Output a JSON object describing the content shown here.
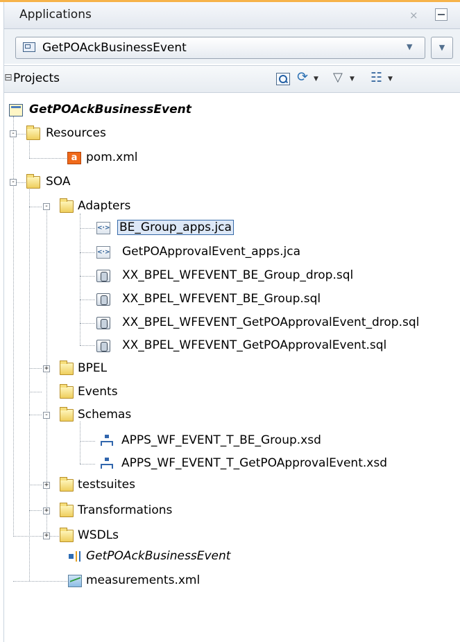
{
  "header": {
    "title": "Applications",
    "close_glyph": "×"
  },
  "app_selector": {
    "value": "GetPOAckBusinessEvent"
  },
  "projects_toolbar": {
    "label": "Projects",
    "icons": [
      "search-icon",
      "sync-icon",
      "filter-icon",
      "layout-icon"
    ]
  },
  "tree": {
    "root": "GetPOAckBusinessEvent",
    "resources": {
      "label": "Resources",
      "children": [
        "pom.xml"
      ]
    },
    "soa": {
      "label": "SOA",
      "adapters": {
        "label": "Adapters",
        "children": [
          "BE_Group_apps.jca",
          "GetPOApprovalEvent_apps.jca",
          "XX_BPEL_WFEVENT_BE_Group_drop.sql",
          "XX_BPEL_WFEVENT_BE_Group.sql",
          "XX_BPEL_WFEVENT_GetPOApprovalEvent_drop.sql",
          "XX_BPEL_WFEVENT_GetPOApprovalEvent.sql"
        ],
        "selected": "BE_Group_apps.jca"
      },
      "bpel": "BPEL",
      "events": "Events",
      "schemas": {
        "label": "Schemas",
        "children": [
          "APPS_WF_EVENT_T_BE_Group.xsd",
          "APPS_WF_EVENT_T_GetPOApprovalEvent.xsd"
        ]
      },
      "testsuites": "testsuites",
      "transformations": "Transformations",
      "wsdls": "WSDLs",
      "composite": "GetPOAckBusinessEvent",
      "measurements": "measurements.xml"
    }
  }
}
